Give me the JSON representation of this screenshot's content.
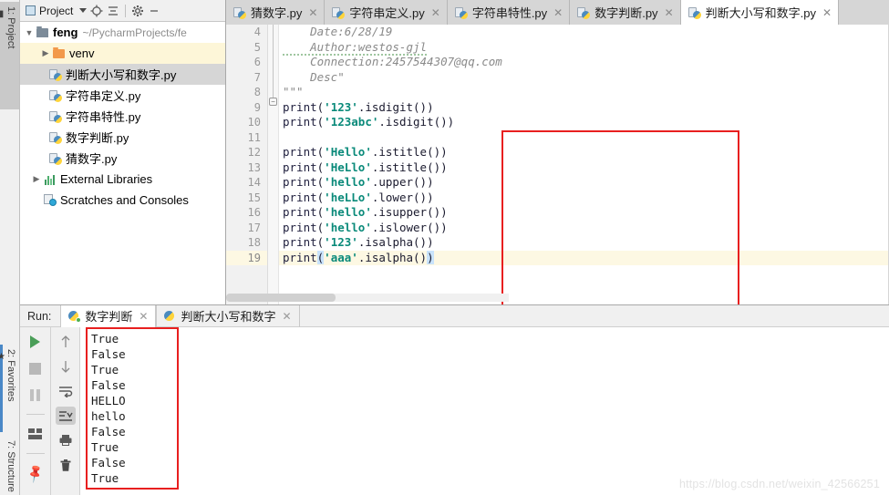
{
  "left_strip": {
    "project": "1: Project",
    "favorites": "2: Favorites",
    "structure": "7: Structure"
  },
  "project_panel": {
    "title": "Project",
    "icons": [
      "select-target-icon",
      "collapse-all-icon",
      "settings-gear-icon",
      "minimize-icon"
    ],
    "tree": [
      {
        "label": "feng",
        "path": "~/PycharmProjects/fe",
        "icon": "folder-icon",
        "expanded": true,
        "state": "normal",
        "depth": 0
      },
      {
        "label": "venv",
        "path": "",
        "icon": "folder-orange-icon",
        "expanded": false,
        "state": "highlighted",
        "depth": 1
      },
      {
        "label": "判断大小写和数字.py",
        "path": "",
        "icon": "python-file-icon",
        "state": "selected",
        "depth": 2
      },
      {
        "label": "字符串定义.py",
        "path": "",
        "icon": "python-file-icon",
        "state": "normal",
        "depth": 2
      },
      {
        "label": "字符串特性.py",
        "path": "",
        "icon": "python-file-icon",
        "state": "normal",
        "depth": 2
      },
      {
        "label": "数字判断.py",
        "path": "",
        "icon": "python-file-icon",
        "state": "normal",
        "depth": 2
      },
      {
        "label": "猜数字.py",
        "path": "",
        "icon": "python-file-icon",
        "state": "normal",
        "depth": 2
      },
      {
        "label": "External Libraries",
        "path": "",
        "icon": "libraries-icon",
        "expanded": false,
        "state": "normal",
        "depth": 0
      },
      {
        "label": "Scratches and Consoles",
        "path": "",
        "icon": "scratches-icon",
        "state": "normal",
        "depth": 0
      }
    ]
  },
  "editor_tabs": [
    {
      "label": "猜数字.py",
      "active": false
    },
    {
      "label": "字符串定义.py",
      "active": false
    },
    {
      "label": "字符串特性.py",
      "active": false
    },
    {
      "label": "数字判断.py",
      "active": false
    },
    {
      "label": "判断大小写和数字.py",
      "active": true
    }
  ],
  "editor": {
    "first_line_number": 4,
    "current_line": 19,
    "lines": [
      {
        "n": 4,
        "type": "doc",
        "text": "    Date:6/28/19"
      },
      {
        "n": 5,
        "type": "doc",
        "text": "    Author:westos-gjl"
      },
      {
        "n": 6,
        "type": "doc",
        "text": "    Connection:2457544307@qq.com"
      },
      {
        "n": 7,
        "type": "doc",
        "text": "    Desc\""
      },
      {
        "n": 8,
        "type": "doc",
        "text": "\"\"\""
      },
      {
        "n": 9,
        "type": "code",
        "fn": "print",
        "arg": "'123'",
        "tail": ".isdigit())"
      },
      {
        "n": 10,
        "type": "code",
        "fn": "print",
        "arg": "'123abc'",
        "tail": ".isdigit())"
      },
      {
        "n": 11,
        "type": "blank",
        "text": ""
      },
      {
        "n": 12,
        "type": "code",
        "fn": "print",
        "arg": "'Hello'",
        "tail": ".istitle())"
      },
      {
        "n": 13,
        "type": "code",
        "fn": "print",
        "arg": "'HeLlo'",
        "tail": ".istitle())"
      },
      {
        "n": 14,
        "type": "code",
        "fn": "print",
        "arg": "'hello'",
        "tail": ".upper())"
      },
      {
        "n": 15,
        "type": "code",
        "fn": "print",
        "arg": "'heLLo'",
        "tail": ".lower())"
      },
      {
        "n": 16,
        "type": "code",
        "fn": "print",
        "arg": "'hello'",
        "tail": ".isupper())"
      },
      {
        "n": 17,
        "type": "code",
        "fn": "print",
        "arg": "'hello'",
        "tail": ".islower())"
      },
      {
        "n": 18,
        "type": "code",
        "fn": "print",
        "arg": "'123'",
        "tail": ".isalpha())"
      },
      {
        "n": 19,
        "type": "code",
        "fn": "print",
        "arg": "'aaa'",
        "tail": ".isalpha())",
        "caret": true
      }
    ]
  },
  "run_panel": {
    "label": "Run:",
    "tabs": [
      {
        "label": "数字判断",
        "active": true,
        "running": true
      },
      {
        "label": "判断大小写和数字",
        "active": false,
        "running": false
      }
    ],
    "toolbar_left": [
      "run-icon",
      "stop-icon",
      "pause-icon",
      "layout-icon",
      "pin-icon"
    ],
    "toolbar_right": [
      "arrow-up-icon",
      "arrow-down-icon",
      "soft-wrap-icon",
      "scroll-to-end-icon",
      "print-icon",
      "trash-icon"
    ],
    "console_output": [
      "True",
      "False",
      "True",
      "False",
      "HELLO",
      "hello",
      "False",
      "True",
      "False",
      "True"
    ]
  },
  "watermark": "https://blog.csdn.net/weixin_42566251",
  "colors": {
    "accent_red": "#e81f1f",
    "string_green": "#0a8a7a",
    "keyword_navy": "#20203f",
    "current_line": "#fdf8e3",
    "selection_gray": "#d6d6d6",
    "run_green": "#4a9e58"
  }
}
